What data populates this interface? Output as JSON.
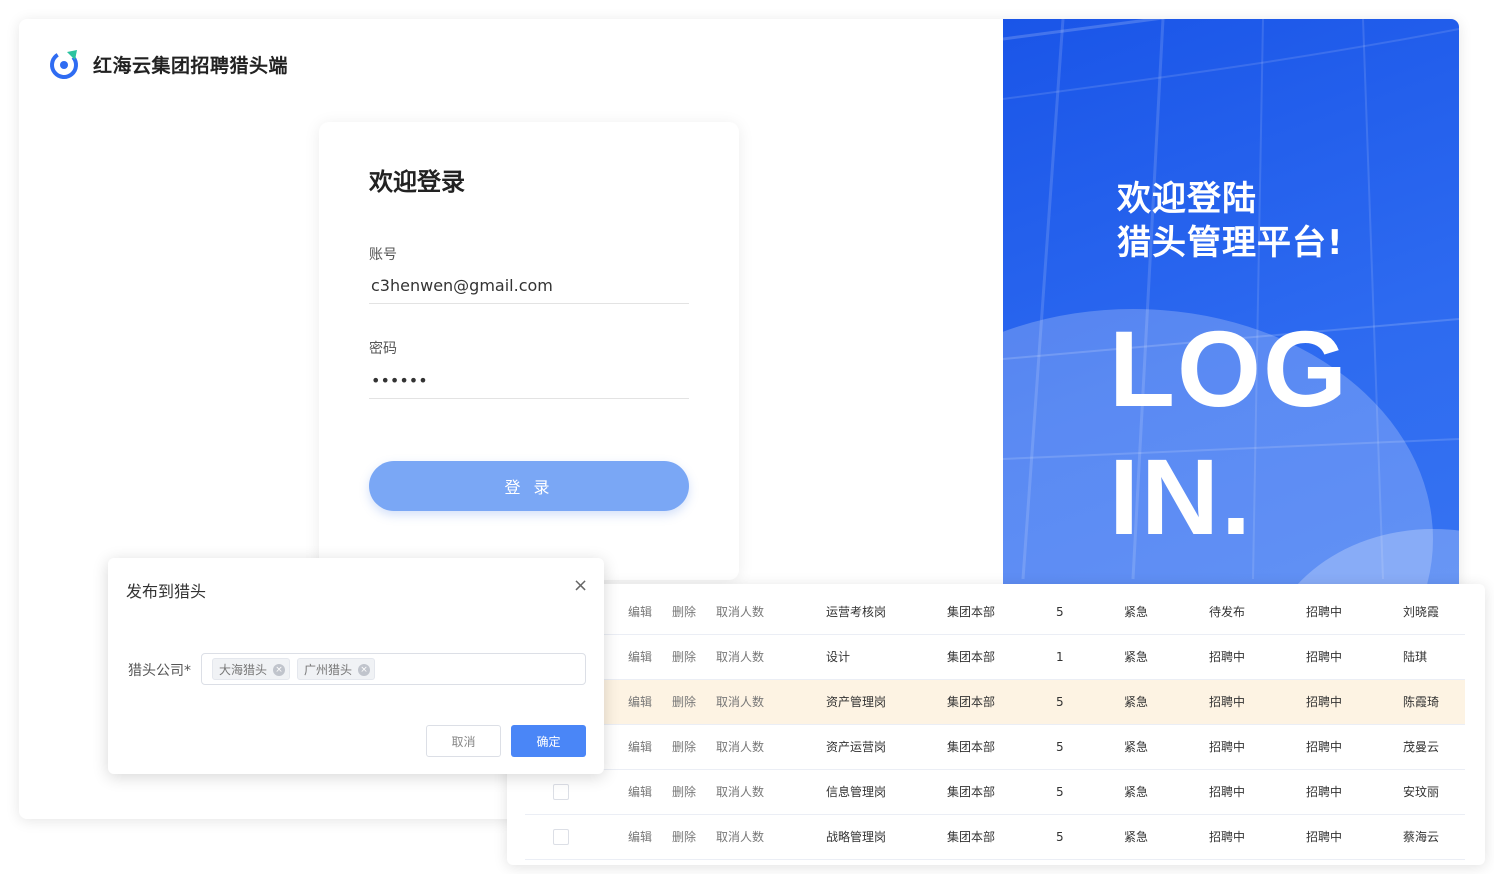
{
  "brand": {
    "name": "红海云集团招聘猎头端"
  },
  "login": {
    "title": "欢迎登录",
    "account_label": "账号",
    "account_value": "c3henwen@gmail.com",
    "password_label": "密码",
    "password_value": "••••••",
    "submit_label": "登 录"
  },
  "hero": {
    "welcome_line1": "欢迎登陆",
    "welcome_line2": "猎头管理平台!",
    "big_line1": "LOG",
    "big_line2": "IN."
  },
  "table": {
    "rows": [
      {
        "checkbox": false,
        "edit": "编辑",
        "delete": "删除",
        "cancel": "取消人数",
        "position": "运营考核岗",
        "dept": "集团本部",
        "count": "5",
        "urgency": "紧急",
        "publish": "待发布",
        "status": "招聘中",
        "owner": "刘晓霞",
        "highlight": false
      },
      {
        "checkbox": false,
        "edit": "编辑",
        "delete": "删除",
        "cancel": "取消人数",
        "position": "设计",
        "dept": "集团本部",
        "count": "1",
        "urgency": "紧急",
        "publish": "招聘中",
        "status": "招聘中",
        "owner": "陆琪",
        "highlight": false
      },
      {
        "checkbox": false,
        "edit": "编辑",
        "delete": "删除",
        "cancel": "取消人数",
        "position": "资产管理岗",
        "dept": "集团本部",
        "count": "5",
        "urgency": "紧急",
        "publish": "招聘中",
        "status": "招聘中",
        "owner": "陈霞琦",
        "highlight": true
      },
      {
        "checkbox": false,
        "edit": "编辑",
        "delete": "删除",
        "cancel": "取消人数",
        "position": "资产运营岗",
        "dept": "集团本部",
        "count": "5",
        "urgency": "紧急",
        "publish": "招聘中",
        "status": "招聘中",
        "owner": "茂曼云",
        "highlight": false
      },
      {
        "checkbox": true,
        "edit": "编辑",
        "delete": "删除",
        "cancel": "取消人数",
        "position": "信息管理岗",
        "dept": "集团本部",
        "count": "5",
        "urgency": "紧急",
        "publish": "招聘中",
        "status": "招聘中",
        "owner": "安玟丽",
        "highlight": false
      },
      {
        "checkbox": true,
        "edit": "编辑",
        "delete": "删除",
        "cancel": "取消人数",
        "position": "战略管理岗",
        "dept": "集团本部",
        "count": "5",
        "urgency": "紧急",
        "publish": "招聘中",
        "status": "招聘中",
        "owner": "蔡海云",
        "highlight": false
      }
    ]
  },
  "dialog": {
    "title": "发布到猎头",
    "close_icon": "×",
    "field_label": "猎头公司*",
    "tags": [
      "大海猎头",
      "广州猎头"
    ],
    "cancel_label": "取消",
    "confirm_label": "确定"
  },
  "colors": {
    "primary": "#4a86f7",
    "login_button": "#7aa7f5",
    "hero_blue": "#2d6af0",
    "row_highlight": "#fdf3e3"
  }
}
